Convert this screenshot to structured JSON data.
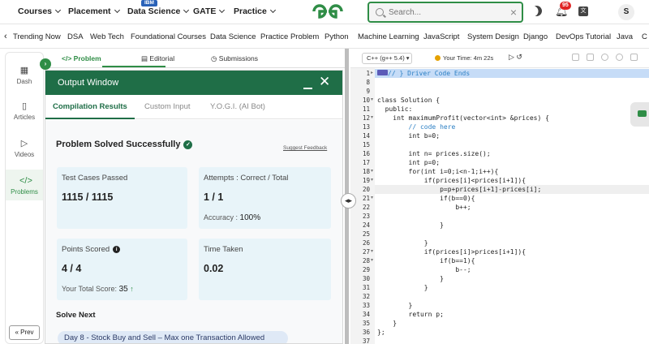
{
  "topnav": {
    "items": [
      {
        "label": "Courses"
      },
      {
        "label": "Placement"
      },
      {
        "label": "Data Science",
        "badge": "IBM"
      },
      {
        "label": "GATE"
      },
      {
        "label": "Practice"
      }
    ],
    "search_placeholder": "Search...",
    "notification_count": "95",
    "translate_glyph": "文",
    "avatar_letter": "S",
    "brand_color": "#2f8d46"
  },
  "subnav": {
    "items": [
      "Trending Now",
      "DSA",
      "Web Tech",
      "Foundational Courses",
      "Data Science",
      "Practice Problem",
      "Python",
      "Machine Learning",
      "JavaScript",
      "System Design",
      "Django",
      "DevOps Tutorial",
      "Java",
      "C"
    ]
  },
  "rail": {
    "items": [
      {
        "label": "Dash",
        "icon": "dashboard-icon"
      },
      {
        "label": "Articles",
        "icon": "book-icon"
      },
      {
        "label": "Videos",
        "icon": "video-icon"
      },
      {
        "label": "Problems",
        "icon": "code-icon"
      }
    ],
    "prev_label": "« Prev"
  },
  "problem_tabs": [
    {
      "label": "</> Problem"
    },
    {
      "label": "Editorial"
    },
    {
      "label": "Submissions"
    }
  ],
  "output_window": {
    "title": "Output Window",
    "tabs": [
      {
        "label": "Compilation Results"
      },
      {
        "label": "Custom Input"
      },
      {
        "label": "Y.O.G.I. (AI Bot)"
      }
    ],
    "status": "Problem Solved Successfully",
    "suggest_feedback": "Suggest Feedback",
    "cards": {
      "test_cases": {
        "label": "Test Cases Passed",
        "value": "1115 / 1115"
      },
      "attempts": {
        "label": "Attempts : Correct / Total",
        "value": "1 / 1",
        "sub_label": "Accuracy :",
        "sub_value": "100%"
      },
      "points": {
        "label": "Points Scored",
        "value": "4 / 4",
        "sub_label": "Your Total Score:",
        "sub_value": "35"
      },
      "time": {
        "label": "Time Taken",
        "value": "0.02"
      }
    },
    "solve_next_label": "Solve Next",
    "next_problem": "Day 8 - Stock Buy and Sell – Max one Transaction Allowed"
  },
  "editor": {
    "language": "C++ (g++ 5.4)",
    "timer_label": "Your Time:",
    "timer_value": "4m 22s",
    "lines": [
      {
        "n": "1",
        "fold": "▸",
        "text": "// } Driver Code Ends",
        "kind": "comment-fold"
      },
      {
        "n": "8",
        "fold": "",
        "text": ""
      },
      {
        "n": "9",
        "fold": "",
        "text": ""
      },
      {
        "n": "10",
        "fold": "▾",
        "text": "class Solution {"
      },
      {
        "n": "11",
        "fold": "",
        "text": "  public:"
      },
      {
        "n": "12",
        "fold": "▾",
        "text": "    int maximumProfit(vector<int> &prices) {"
      },
      {
        "n": "13",
        "fold": "",
        "text": "        // code here",
        "kind": "comment"
      },
      {
        "n": "14",
        "fold": "",
        "text": "        int b=0;"
      },
      {
        "n": "15",
        "fold": "",
        "text": ""
      },
      {
        "n": "16",
        "fold": "",
        "text": "        int n= prices.size();"
      },
      {
        "n": "17",
        "fold": "",
        "text": "        int p=0;"
      },
      {
        "n": "18",
        "fold": "▾",
        "text": "        for(int i=0;i<n-1;i++){"
      },
      {
        "n": "19",
        "fold": "▾",
        "text": "            if(prices[i]<prices[i+1]){"
      },
      {
        "n": "20",
        "fold": "",
        "text": "                p=p+prices[i+1]-prices[i];",
        "kind": "active"
      },
      {
        "n": "21",
        "fold": "▾",
        "text": "                if(b==0){"
      },
      {
        "n": "22",
        "fold": "",
        "text": "                    b++;"
      },
      {
        "n": "23",
        "fold": "",
        "text": ""
      },
      {
        "n": "24",
        "fold": "",
        "text": "                }"
      },
      {
        "n": "25",
        "fold": "",
        "text": ""
      },
      {
        "n": "26",
        "fold": "",
        "text": "            }"
      },
      {
        "n": "27",
        "fold": "▾",
        "text": "            if(prices[i]>prices[i+1]){"
      },
      {
        "n": "28",
        "fold": "▾",
        "text": "                if(b==1){"
      },
      {
        "n": "29",
        "fold": "",
        "text": "                    b--;"
      },
      {
        "n": "30",
        "fold": "",
        "text": "                }"
      },
      {
        "n": "31",
        "fold": "",
        "text": "            }"
      },
      {
        "n": "32",
        "fold": "",
        "text": ""
      },
      {
        "n": "33",
        "fold": "",
        "text": "        }"
      },
      {
        "n": "34",
        "fold": "",
        "text": "        return p;"
      },
      {
        "n": "35",
        "fold": "",
        "text": "    }"
      },
      {
        "n": "36",
        "fold": "",
        "text": "};"
      },
      {
        "n": "37",
        "fold": "",
        "text": ""
      },
      {
        "n": "38",
        "fold": "",
        "text": ""
      }
    ]
  }
}
